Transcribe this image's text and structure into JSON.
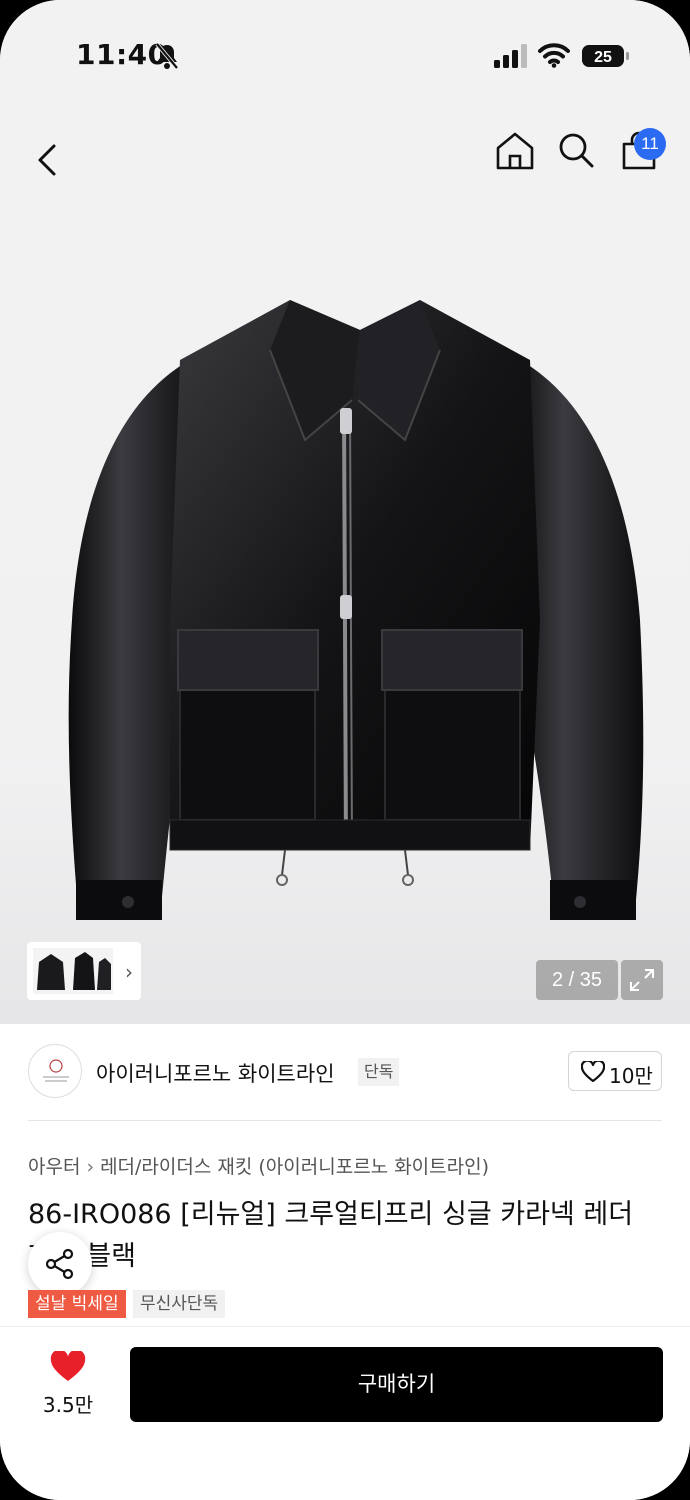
{
  "status_bar": {
    "time": "11:40",
    "battery": "25"
  },
  "nav": {
    "cart_count": "11"
  },
  "gallery": {
    "counter": "2 / 35"
  },
  "brand": {
    "name": "아이러니포르노 화이트라인",
    "tag": "단독",
    "follow_count": "10만"
  },
  "breadcrumb": {
    "category": "아우터",
    "subcategory": "레더/라이더스 재킷 (아이러니포르노 화이트라인)"
  },
  "product": {
    "title": "86-IRO086 [리뉴얼] 크루얼티프리 싱글 카라넥 레더 재킷 블랙",
    "badges": [
      "설날 빅세일",
      "무신사단독"
    ]
  },
  "bottom_bar": {
    "like_count": "3.5만",
    "buy_label": "구매하기"
  },
  "colors": {
    "accent_red": "#ef5a43",
    "badge_blue": "#2a6bf2",
    "heart": "#e8202a"
  }
}
